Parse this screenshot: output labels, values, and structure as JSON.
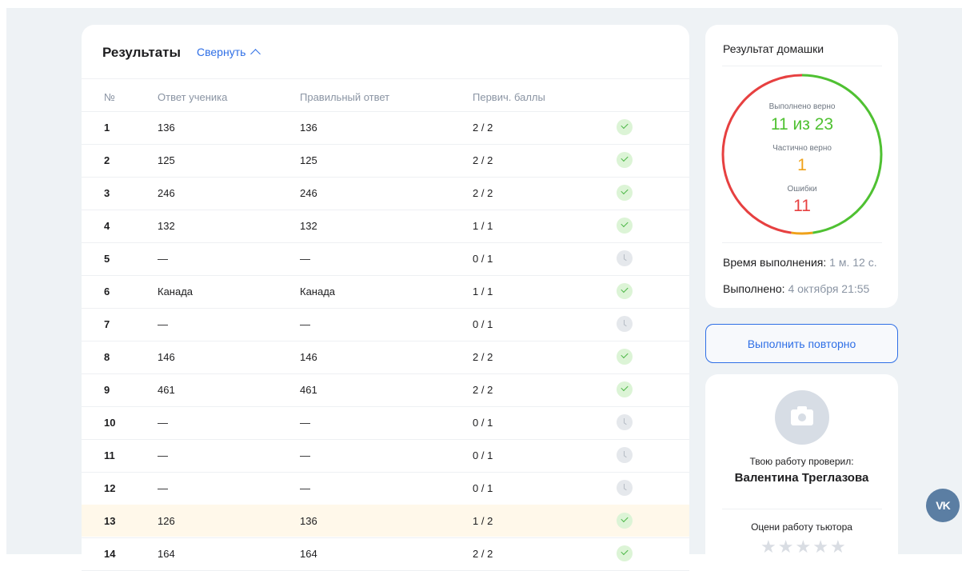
{
  "results": {
    "title": "Результаты",
    "collapse_label": "Свернуть",
    "columns": [
      "№",
      "Ответ ученика",
      "Правильный ответ",
      "Первич. баллы"
    ],
    "rows": [
      {
        "num": "1",
        "student": "136",
        "correct": "136",
        "score": "2 / 2",
        "status": "ok"
      },
      {
        "num": "2",
        "student": "125",
        "correct": "125",
        "score": "2 / 2",
        "status": "ok"
      },
      {
        "num": "3",
        "student": "246",
        "correct": "246",
        "score": "2 / 2",
        "status": "ok"
      },
      {
        "num": "4",
        "student": "132",
        "correct": "132",
        "score": "1 / 1",
        "status": "ok"
      },
      {
        "num": "5",
        "student": "—",
        "correct": "—",
        "score": "0 / 1",
        "status": "pending"
      },
      {
        "num": "6",
        "student": "Канада",
        "correct": "Канада",
        "score": "1 / 1",
        "status": "ok"
      },
      {
        "num": "7",
        "student": "—",
        "correct": "—",
        "score": "0 / 1",
        "status": "pending"
      },
      {
        "num": "8",
        "student": "146",
        "correct": "146",
        "score": "2 / 2",
        "status": "ok"
      },
      {
        "num": "9",
        "student": "461",
        "correct": "461",
        "score": "2 / 2",
        "status": "ok"
      },
      {
        "num": "10",
        "student": "—",
        "correct": "—",
        "score": "0 / 1",
        "status": "pending"
      },
      {
        "num": "11",
        "student": "—",
        "correct": "—",
        "score": "0 / 1",
        "status": "pending"
      },
      {
        "num": "12",
        "student": "—",
        "correct": "—",
        "score": "0 / 1",
        "status": "pending"
      },
      {
        "num": "13",
        "student": "126",
        "correct": "136",
        "score": "1 / 2",
        "status": "ok",
        "highlight": true
      },
      {
        "num": "14",
        "student": "164",
        "correct": "164",
        "score": "2 / 2",
        "status": "ok"
      }
    ]
  },
  "summary": {
    "title": "Результат домашки",
    "correct_label": "Выполнено верно",
    "correct_value": "11 из 23",
    "partial_label": "Частично верно",
    "partial_value": "1",
    "errors_label": "Ошибки",
    "errors_value": "11",
    "ring": {
      "correct": 11,
      "partial": 1,
      "errors": 11,
      "total": 23
    },
    "time_label": "Время выполнения:",
    "time_value": "1 м. 12 с.",
    "done_label": "Выполнено:",
    "done_value": "4 октября 21:55"
  },
  "repeat_button": "Выполнить повторно",
  "tutor": {
    "caption": "Твою работу проверил:",
    "name": "Валентина Треглазова",
    "rate_caption": "Оцени работу тьютора",
    "stars": 5
  },
  "vk_label": "VK",
  "colors": {
    "accent": "#2f6fe6",
    "correct": "#4fc132",
    "partial": "#f0a21a",
    "errors": "#e74040"
  }
}
